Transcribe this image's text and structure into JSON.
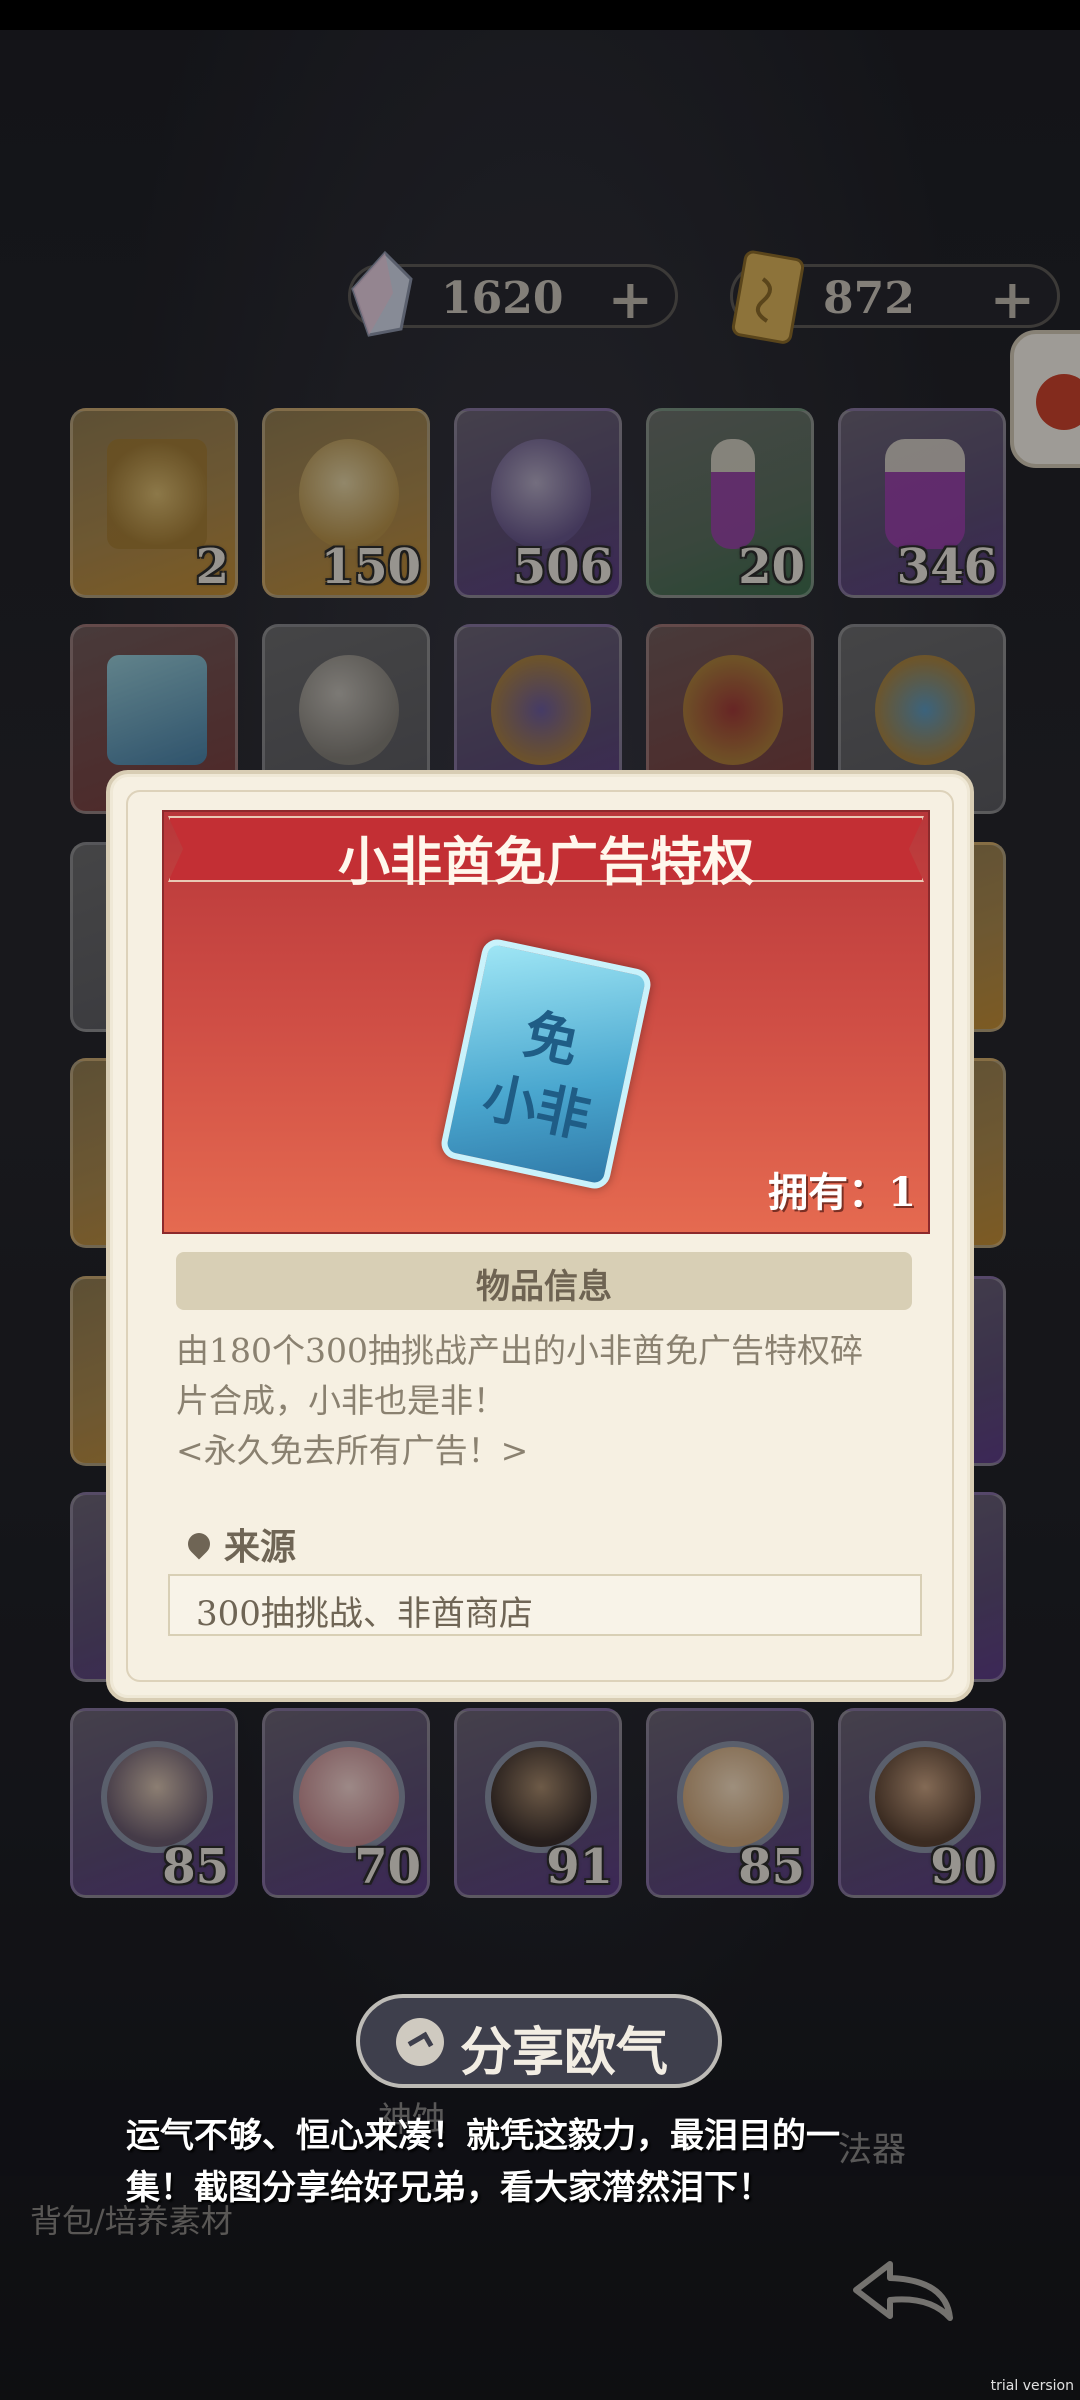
{
  "currencies": [
    {
      "icon": "crystal-icon",
      "value": "1620",
      "plus": "+"
    },
    {
      "icon": "ticket-icon",
      "value": "872",
      "plus": "+"
    }
  ],
  "grid": {
    "row1": [
      "2",
      "150",
      "506",
      "20",
      "346"
    ],
    "row_chars": [
      "85",
      "70",
      "91",
      "85",
      "90"
    ]
  },
  "popup": {
    "title": "小非酋免广告特权",
    "ticket_top": "免",
    "ticket_bottom": "小非",
    "owned": "拥有：1",
    "section_title": "物品信息",
    "desc_lines": [
      "由180个300抽挑战产出的小非酋免广告特权碎",
      "片合成，小非也是非！",
      "<永久免去所有广告！>"
    ],
    "source_label": "来源",
    "source_value": "300抽挑战、非酋商店"
  },
  "share": {
    "button_label": "分享欧气",
    "text_line1": "运气不够、恒心来凑！就凭这毅力，最泪目的一",
    "text_line2": "集！截图分享给好兄弟，看大家潸然泪下！"
  },
  "background_labels": {
    "tab_partial": "神蚀",
    "tab_right": "法器",
    "breadcrumb": "背包/培养素材"
  },
  "watermark": "trial version"
}
